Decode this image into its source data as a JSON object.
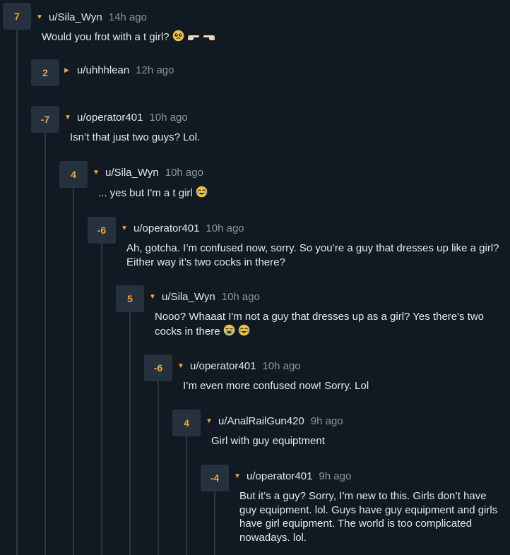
{
  "comments": [
    {
      "score": "7",
      "username": "u/Sila_Wyn",
      "time": "14h ago",
      "body": "Would you frot with a t girl?",
      "emojis": [
        "pleading-face",
        "point-right",
        "point-left"
      ],
      "collapsed": false
    },
    {
      "score": "2",
      "username": "u/uhhhlean",
      "time": "12h ago",
      "body": "",
      "emojis": [],
      "collapsed": true
    },
    {
      "score": "-7",
      "username": "u/operator401",
      "time": "10h ago",
      "body": "Isn’t that just two guys? Lol.",
      "emojis": [],
      "collapsed": false
    },
    {
      "score": "4",
      "username": "u/Sila_Wyn",
      "time": "10h ago",
      "body": "... yes but I'm a t girl",
      "emojis": [
        "joy"
      ],
      "collapsed": false
    },
    {
      "score": "-6",
      "username": "u/operator401",
      "time": "10h ago",
      "body": "Ah, gotcha. I’m confused now, sorry. So you’re a guy that dresses up like a girl? Either way it’s two cocks in there?",
      "emojis": [],
      "collapsed": false
    },
    {
      "score": "5",
      "username": "u/Sila_Wyn",
      "time": "10h ago",
      "body": "Nooo? Whaaat I'm not a guy that dresses up as a girl? Yes there's two cocks in there",
      "emojis": [
        "sob",
        "joy"
      ],
      "collapsed": false
    },
    {
      "score": "-6",
      "username": "u/operator401",
      "time": "10h ago",
      "body": "I’m even more confused now! Sorry. Lol",
      "emojis": [],
      "collapsed": false
    },
    {
      "score": "4",
      "username": "u/AnalRailGun420",
      "time": "9h ago",
      "body": "Girl with guy equiptment",
      "emojis": [],
      "collapsed": false
    },
    {
      "score": "-4",
      "username": "u/operator401",
      "time": "9h ago",
      "body": "But it’s a guy? Sorry, I’m new to this. Girls don’t have guy equipment. lol. Guys have guy equipment and girls have girl equipment. The world is too complicated nowadays. lol.",
      "emojis": [],
      "collapsed": false
    }
  ],
  "colors": {
    "background": "#111922",
    "vote_box": "#26313e",
    "accent": "#f0a43a",
    "thread_line": "#2c3745",
    "text": "#e6e8ea",
    "muted": "#8e959c"
  }
}
